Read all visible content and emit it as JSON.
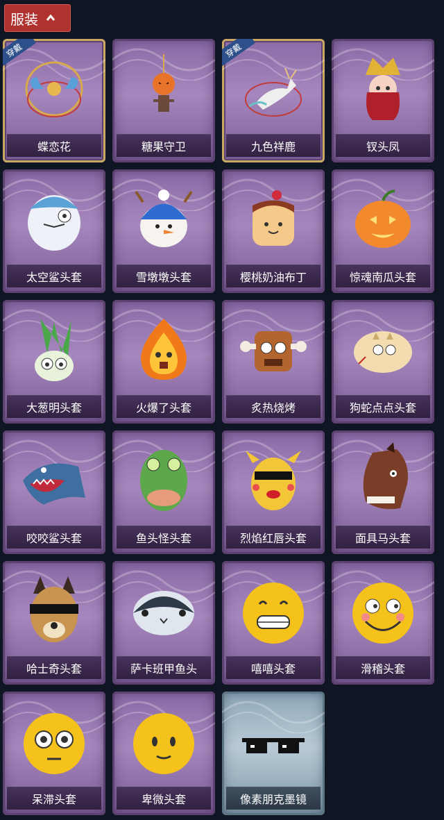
{
  "header": {
    "title": "服装"
  },
  "equipped_tag": "穿戴",
  "items": [
    {
      "label": "蝶恋花",
      "icon": "butterfly-flower-ornament",
      "equipped": true,
      "theme": "purple"
    },
    {
      "label": "糖果守卫",
      "icon": "pumpkin-scarecrow-charm",
      "equipped": false,
      "theme": "purple"
    },
    {
      "label": "九色祥鹿",
      "icon": "nine-color-deer-ornament",
      "equipped": true,
      "theme": "purple"
    },
    {
      "label": "钗头凤",
      "icon": "phoenix-headdress-doll",
      "equipped": false,
      "theme": "purple"
    },
    {
      "label": "太空鲨头套",
      "icon": "space-shark-helmet",
      "equipped": false,
      "theme": "purple"
    },
    {
      "label": "雪墩墩头套",
      "icon": "snowman-beanie-helmet",
      "equipped": false,
      "theme": "purple"
    },
    {
      "label": "樱桃奶油布丁",
      "icon": "cherry-pudding-helmet",
      "equipped": false,
      "theme": "purple"
    },
    {
      "label": "惊魂南瓜头套",
      "icon": "jack-o-lantern-helmet",
      "equipped": false,
      "theme": "purple"
    },
    {
      "label": "大葱明头套",
      "icon": "green-onion-helmet",
      "equipped": false,
      "theme": "purple"
    },
    {
      "label": "火爆了头套",
      "icon": "fireball-helmet",
      "equipped": false,
      "theme": "purple"
    },
    {
      "label": "炙热烧烤",
      "icon": "bbq-meat-helmet",
      "equipped": false,
      "theme": "purple"
    },
    {
      "label": "狗蛇点点头套",
      "icon": "snake-dog-helmet",
      "equipped": false,
      "theme": "purple"
    },
    {
      "label": "咬咬鲨头套",
      "icon": "biting-shark-helmet",
      "equipped": false,
      "theme": "purple"
    },
    {
      "label": "鱼头怪头套",
      "icon": "fish-monster-helmet",
      "equipped": false,
      "theme": "purple"
    },
    {
      "label": "烈焰红唇头套",
      "icon": "red-lips-yellow-helmet",
      "equipped": false,
      "theme": "purple"
    },
    {
      "label": "面具马头套",
      "icon": "horse-mask-helmet",
      "equipped": false,
      "theme": "purple"
    },
    {
      "label": "哈士奇头套",
      "icon": "husky-sunglasses-helmet",
      "equipped": false,
      "theme": "purple"
    },
    {
      "label": "萨卡班甲鱼头",
      "icon": "sacabambaspis-helmet",
      "equipped": false,
      "theme": "purple"
    },
    {
      "label": "嘻嘻头套",
      "icon": "grin-emoji-helmet",
      "equipped": false,
      "theme": "purple"
    },
    {
      "label": "滑稽头套",
      "icon": "funny-emoji-helmet",
      "equipped": false,
      "theme": "purple"
    },
    {
      "label": "呆滞头套",
      "icon": "dazed-emoji-helmet",
      "equipped": false,
      "theme": "purple"
    },
    {
      "label": "卑微头套",
      "icon": "humble-emoji-helmet",
      "equipped": false,
      "theme": "purple"
    },
    {
      "label": "像素朋克墨镜",
      "icon": "pixel-sunglasses",
      "equipped": false,
      "theme": "blue"
    }
  ]
}
